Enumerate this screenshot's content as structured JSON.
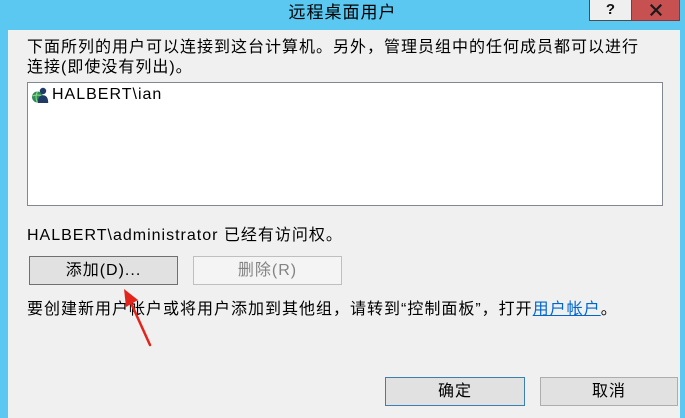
{
  "window": {
    "title": "远程桌面用户",
    "help_glyph": "?",
    "help_icon": "help-icon",
    "close_icon": "close-icon"
  },
  "main": {
    "description_lines": [
      "下面所列的用户可以连接到这台计算机。另外，管理员组中的任何成员都可以进行",
      "连接(即使没有列出)。"
    ],
    "users_list": {
      "items": [
        {
          "label": "HALBERT\\ian",
          "icon": "user-icon"
        }
      ]
    },
    "existing_access_text": "HALBERT\\administrator 已经有访问权。",
    "add_button_label": "添加(D)...",
    "remove_button_label": "删除(R)",
    "remove_button_enabled": false,
    "control_panel_hint": {
      "prefix": "要创建新用户帐户或将用户添加到其他组，请转到“控制面板”，打开",
      "link_label": "用户帐户",
      "suffix": "。"
    }
  },
  "footer": {
    "ok_label": "确定",
    "cancel_label": "取消"
  },
  "colors": {
    "titlebar": "#5ac8f0",
    "close_button": "#c75050",
    "link": "#0066cc",
    "default_button_border": "#3c7fb1",
    "annotation_arrow": "#e3241b"
  }
}
